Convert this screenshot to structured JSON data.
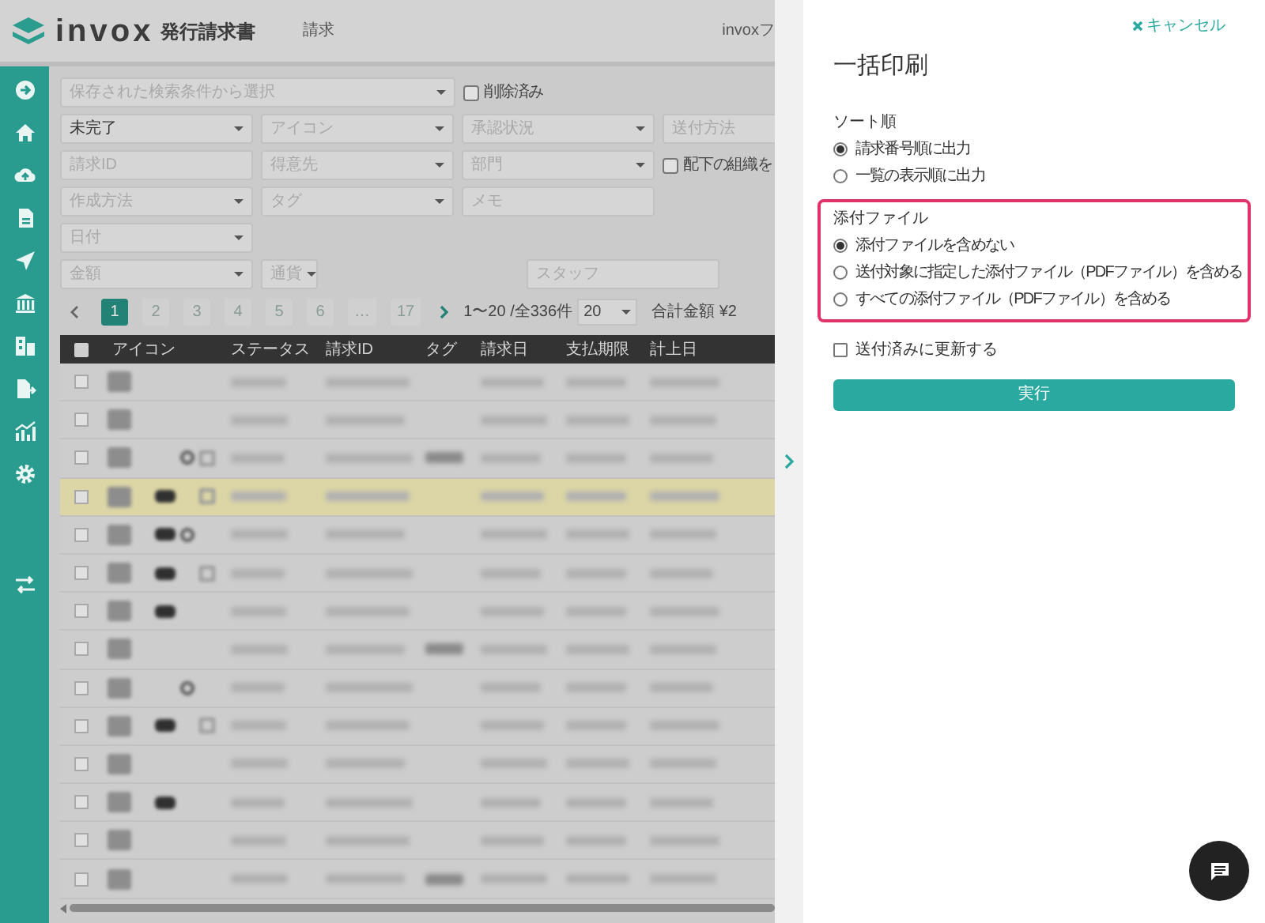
{
  "header": {
    "logo": "invox",
    "product": "発行請求書",
    "nav": "請求",
    "account": "invoxフ"
  },
  "sidebar": {
    "items": [
      {
        "kind": "arrow"
      },
      {
        "kind": "home"
      },
      {
        "kind": "upload"
      },
      {
        "kind": "file"
      },
      {
        "kind": "send"
      },
      {
        "kind": "bank"
      },
      {
        "kind": "building"
      },
      {
        "kind": "export"
      },
      {
        "kind": "chart"
      },
      {
        "kind": "gear"
      },
      {
        "kind": "gap"
      },
      {
        "kind": "exchange"
      }
    ]
  },
  "filter_rows": [
    [
      {
        "kind": "wide",
        "placeholder": "保存された検索条件から選択"
      },
      {
        "kind": "checkbox",
        "label": "削除済み",
        "checked": false
      }
    ],
    [
      {
        "kind": "select",
        "value": "未完了"
      },
      {
        "kind": "select",
        "placeholder": "アイコン"
      },
      {
        "kind": "select",
        "placeholder": "承認状況"
      },
      {
        "kind": "input",
        "placeholder": "送付方法"
      }
    ],
    [
      {
        "kind": "input",
        "placeholder": "請求ID"
      },
      {
        "kind": "select",
        "placeholder": "得意先"
      },
      {
        "kind": "select",
        "placeholder": "部門"
      },
      {
        "kind": "checkbox",
        "label": "配下の組織を",
        "checked": false
      }
    ],
    [
      {
        "kind": "select",
        "placeholder": "作成方法"
      },
      {
        "kind": "select",
        "placeholder": "タグ"
      },
      {
        "kind": "input",
        "placeholder": "メモ"
      }
    ],
    [
      {
        "kind": "select",
        "placeholder": "日付"
      }
    ],
    [
      {
        "kind": "select",
        "placeholder": "金額"
      },
      {
        "kind": "small",
        "placeholder": "通貨"
      },
      {
        "kind": "spacer"
      },
      {
        "kind": "input",
        "placeholder": "スタッフ"
      }
    ]
  ],
  "pagination": {
    "pages": [
      {
        "label": "1",
        "selected": true
      },
      {
        "label": "2",
        "selected": false
      },
      {
        "label": "3",
        "selected": false
      },
      {
        "label": "4",
        "selected": false
      },
      {
        "label": "5",
        "selected": false
      },
      {
        "label": "6",
        "selected": false
      },
      {
        "label": "…",
        "selected": false
      },
      {
        "label": "17",
        "selected": false
      }
    ],
    "range": "1〜20 /全336件",
    "per_page": "20",
    "total": "合計金額 ¥2"
  },
  "table": {
    "all_checked": false,
    "columns": [
      "アイコン",
      "ステータス",
      "請求ID",
      "タグ",
      "請求日",
      "支払期限",
      "計上日"
    ],
    "rows": [
      {
        "selected": false,
        "stamp": false,
        "clip": false,
        "memo": false,
        "tag": false
      },
      {
        "selected": false,
        "stamp": false,
        "clip": false,
        "memo": false,
        "tag": false
      },
      {
        "selected": false,
        "stamp": false,
        "clip": true,
        "memo": true,
        "tag": true
      },
      {
        "selected": true,
        "stamp": true,
        "clip": false,
        "memo": true,
        "tag": false
      },
      {
        "selected": false,
        "stamp": true,
        "clip": true,
        "memo": false,
        "tag": false
      },
      {
        "selected": false,
        "stamp": true,
        "clip": false,
        "memo": true,
        "tag": false
      },
      {
        "selected": false,
        "stamp": true,
        "clip": false,
        "memo": false,
        "tag": false
      },
      {
        "selected": false,
        "stamp": false,
        "clip": false,
        "memo": false,
        "tag": true
      },
      {
        "selected": false,
        "stamp": false,
        "clip": true,
        "memo": false,
        "tag": false
      },
      {
        "selected": false,
        "stamp": true,
        "clip": false,
        "memo": true,
        "tag": false
      },
      {
        "selected": false,
        "stamp": false,
        "clip": false,
        "memo": false,
        "tag": false
      },
      {
        "selected": false,
        "stamp": true,
        "clip": false,
        "memo": false,
        "tag": false
      },
      {
        "selected": false,
        "stamp": false,
        "clip": false,
        "memo": false,
        "tag": false
      },
      {
        "selected": false,
        "stamp": false,
        "clip": false,
        "memo": false,
        "tag": true
      }
    ]
  },
  "panel": {
    "cancel": "キャンセル",
    "title": "一括印刷",
    "sections": [
      {
        "label": "ソート順",
        "highlighted": false,
        "options": [
          {
            "label": "請求番号順に出力",
            "selected": true
          },
          {
            "label": "一覧の表示順に出力",
            "selected": false
          }
        ]
      },
      {
        "label": "添付ファイル",
        "highlighted": true,
        "options": [
          {
            "label": "添付ファイルを含めない",
            "selected": true
          },
          {
            "label": "送付対象に指定した添付ファイル（PDFファイル）を含める",
            "selected": false
          },
          {
            "label": "すべての添付ファイル（PDFファイル）を含める",
            "selected": false
          }
        ]
      }
    ],
    "checkbox": {
      "label": "送付済みに更新する",
      "checked": false
    },
    "submit": "実行"
  }
}
